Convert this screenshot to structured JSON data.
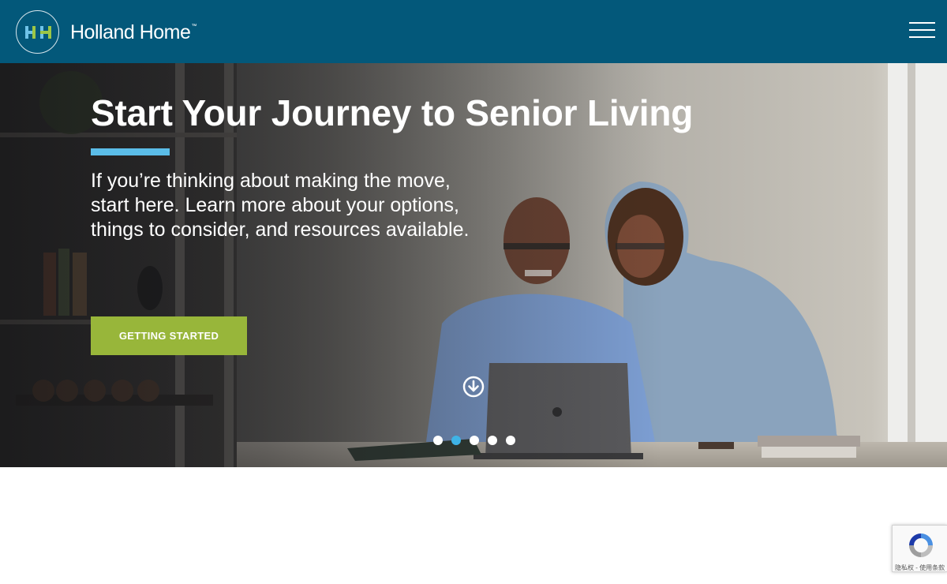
{
  "header": {
    "brand_name": "Holland Home",
    "brand_tm": "™",
    "logo_icon": "hh-monogram-icon",
    "menu_icon": "hamburger-menu-icon",
    "background_color": "#03587a"
  },
  "hero": {
    "title": "Start Your Journey to Senior Living",
    "subtitle": "If you’re thinking about making the move, start here. Learn more about your options, things to consider, and resources available.",
    "cta_label": "GETTING STARTED",
    "cta_color": "#98b63a",
    "accent_color": "#5bbde8",
    "scroll_icon": "arrow-down-circle-icon",
    "carousel": {
      "slide_count": 5,
      "active_index": 1,
      "active_color": "#3eb3e6"
    }
  },
  "recaptcha": {
    "icon": "recaptcha-icon",
    "footer_text": "隐私权 - 使用条款"
  }
}
